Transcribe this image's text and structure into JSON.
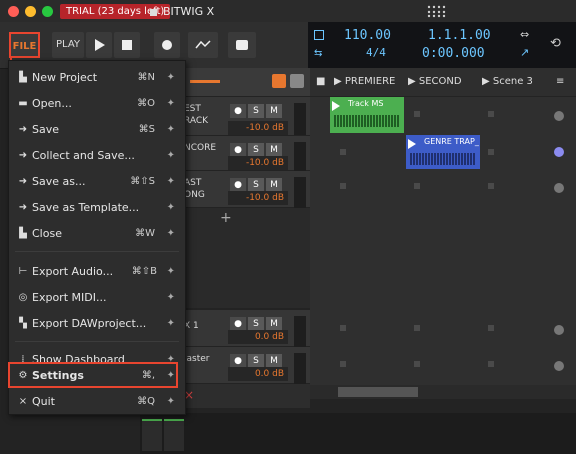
{
  "titlebar": {
    "trial_badge": "TRIAL (23 days left)",
    "doc_tab": "BITWIG",
    "doc_close": "X"
  },
  "toolbar": {
    "file": "FILE",
    "play_label": "PLAY",
    "tempo": "110.00",
    "time_sig": "4/4",
    "position": "1.1.1.00",
    "time": "0:00.000"
  },
  "tracks": [
    {
      "name": "EST\nRACK",
      "db": "-10.0 dB"
    },
    {
      "name": "NCORE",
      "db": "-10.0 dB"
    },
    {
      "name": "AST\nONG",
      "db": "-10.0 dB"
    },
    {
      "name": "X 1",
      "db": "0.0 dB"
    },
    {
      "name": "laster",
      "db": "0.0 dB"
    }
  ],
  "scenes": [
    "PREMIERE",
    "SECOND",
    "Scene 3"
  ],
  "clips": {
    "track_ms": "Track MS",
    "genre": "GENRE TRAP_"
  },
  "mini_buttons": {
    "s": "S",
    "m": "M"
  },
  "menu": {
    "items": [
      {
        "label": "New Project",
        "shortcut": "⌘N",
        "icon": "new-file-icon"
      },
      {
        "label": "Open...",
        "shortcut": "⌘O",
        "icon": "folder-icon"
      },
      {
        "label": "Save",
        "shortcut": "⌘S",
        "icon": "save-icon"
      },
      {
        "label": "Collect and Save...",
        "shortcut": "",
        "icon": "collect-save-icon"
      },
      {
        "label": "Save as...",
        "shortcut": "⌘⇧S",
        "icon": "save-as-icon"
      },
      {
        "label": "Save as Template...",
        "shortcut": "",
        "icon": "template-icon"
      },
      {
        "label": "Close",
        "shortcut": "⌘W",
        "icon": "close-file-icon"
      },
      {
        "label": "Export Audio...",
        "shortcut": "⌘⇧B",
        "icon": "export-audio-icon"
      },
      {
        "label": "Export MIDI...",
        "shortcut": "",
        "icon": "export-midi-icon"
      },
      {
        "label": "Export DAWproject...",
        "shortcut": "",
        "icon": "export-dawproject-icon"
      },
      {
        "label": "Show Dashboard",
        "shortcut": "",
        "icon": "dashboard-icon"
      },
      {
        "label": "Settings",
        "shortcut": "⌘,",
        "icon": "gear-icon"
      },
      {
        "label": "Quit",
        "shortcut": "⌘Q",
        "icon": "quit-icon"
      }
    ]
  },
  "colors": {
    "accent": "#e7772f",
    "highlight": "#e8452f",
    "clip_green": "#4caf50",
    "clip_blue": "#3d5cc8"
  }
}
